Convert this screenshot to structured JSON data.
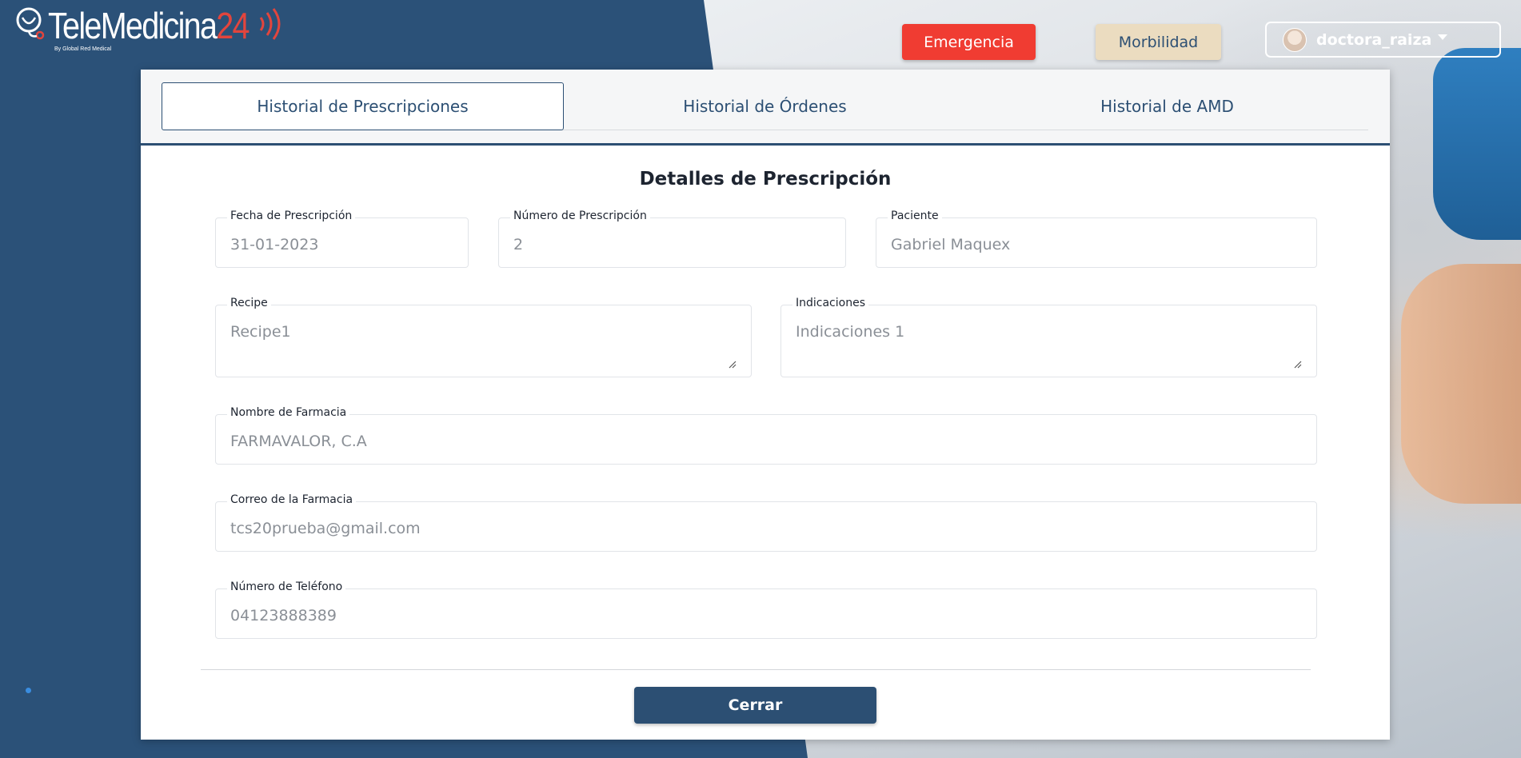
{
  "header": {
    "logo_main": "TeleMedicina",
    "logo_num": "24",
    "logo_sub": "By Global Red Medical",
    "emergency_label": "Emergencia",
    "morbidity_label": "Morbilidad",
    "username": "doctora_raiza"
  },
  "tabs": [
    {
      "label": "Historial de Prescripciones",
      "active": true
    },
    {
      "label": "Historial de Órdenes",
      "active": false
    },
    {
      "label": "Historial de AMD",
      "active": false
    }
  ],
  "form": {
    "title": "Detalles de Prescripción",
    "fecha": {
      "label": "Fecha de Prescripción",
      "value": "31-01-2023"
    },
    "numero": {
      "label": "Número de Prescripción",
      "value": "2"
    },
    "paciente": {
      "label": "Paciente",
      "value": "Gabriel Maquex"
    },
    "recipe": {
      "label": "Recipe",
      "value": "Recipe1"
    },
    "indicaciones": {
      "label": "Indicaciones",
      "value": "Indicaciones 1"
    },
    "farmacia": {
      "label": "Nombre de Farmacia",
      "value": "FARMAVALOR, C.A"
    },
    "correo": {
      "label": "Correo de la Farmacia",
      "value": "tcs20prueba@gmail.com"
    },
    "telefono": {
      "label": "Número de Teléfono",
      "value": "04123888389"
    }
  },
  "actions": {
    "close_label": "Cerrar"
  },
  "colors": {
    "primary": "#2c4f73",
    "emergency": "#f03c32",
    "morbidity": "#ebdcc0"
  }
}
